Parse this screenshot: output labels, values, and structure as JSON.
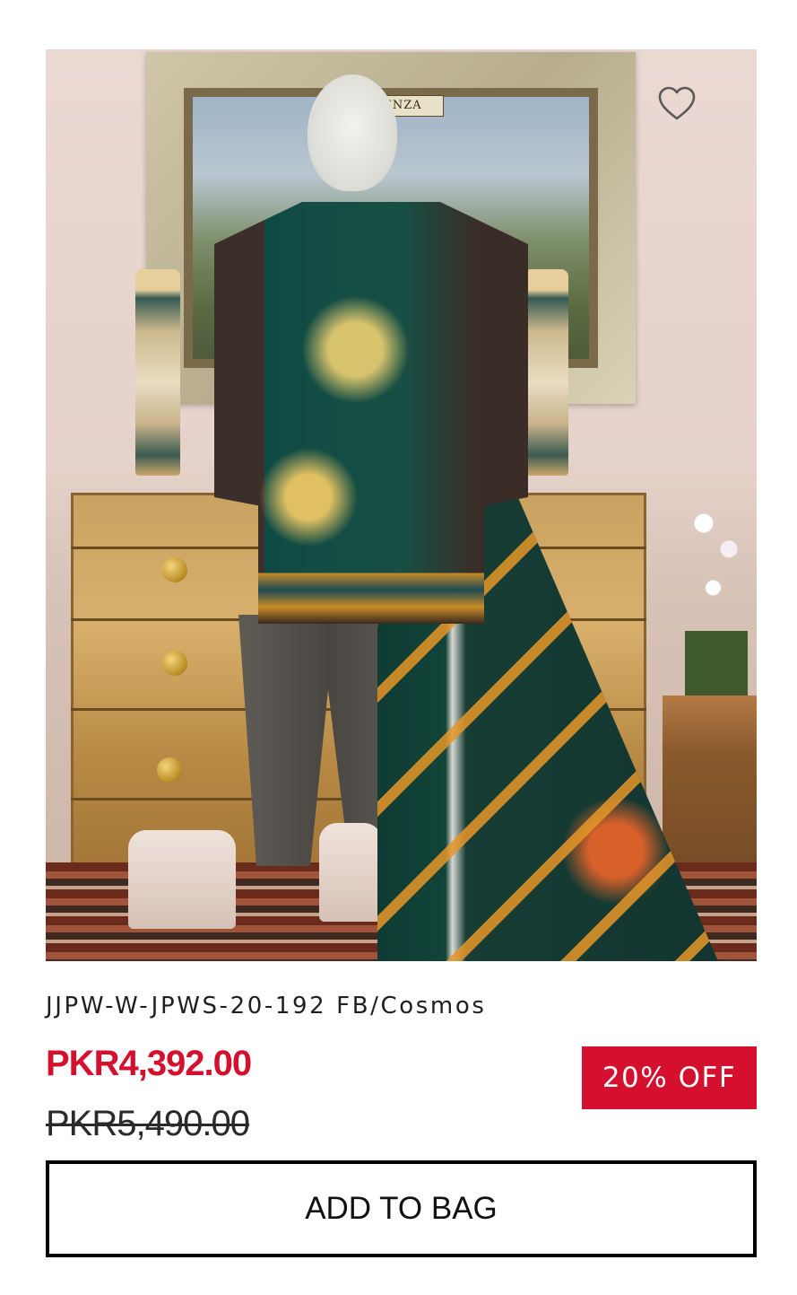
{
  "product": {
    "image_alt": "Woman's printed suit on mannequin with dupatta",
    "wishlist_icon": "heart-outline-icon",
    "name": "JJPW-W-JPWS-20-192 FB/Cosmos",
    "sale_price": "PKR4,392.00",
    "original_price": "PKR5,490.00",
    "discount_label": "20% OFF",
    "add_to_bag_label": "ADD TO BAG"
  },
  "scene": {
    "tapestry_banner": "ENZA"
  },
  "colors": {
    "accent": "#d4102e",
    "button_border": "#000000"
  }
}
